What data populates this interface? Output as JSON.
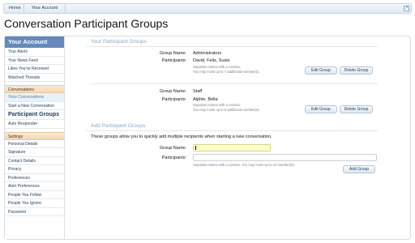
{
  "breadcrumb": {
    "home": "Home",
    "account": "Your Account",
    "jump_icon": "external-link-icon"
  },
  "page_title": "Conversation Participant Groups",
  "sidebar": {
    "header": "Your Account",
    "items_top": [
      "Your Alerts",
      "Your News Feed",
      "Likes You've Received",
      "Watched Threads"
    ],
    "conversations_section": "Conversations",
    "conv_items": [
      "View Conversations",
      "Start a New Conversation"
    ],
    "participant_groups": "Participant Groups",
    "auto_responder": "Auto Responder",
    "settings_section": "Settings",
    "settings_items": [
      "Personal Details",
      "Signature",
      "Contact Details",
      "Privacy",
      "Preferences",
      "Alert Preferences",
      "People You Follow",
      "People You Ignore",
      "Password"
    ]
  },
  "your_groups": {
    "title": "Your Participant Groups",
    "group_name_label": "Group Name:",
    "participants_label": "Participants:",
    "edit_label": "Edit Group",
    "delete_label": "Delete Group",
    "groups": [
      {
        "name": "Administrators",
        "participants": "David, Felix, Susie",
        "hint1": "Separate names with a comma.",
        "hint2": "You may invite up to 7 additional member(s)."
      },
      {
        "name": "Staff",
        "participants": "Alphie, Bella",
        "hint1": "Separate names with a comma.",
        "hint2": "You may invite up to 8 additional member(s)."
      }
    ]
  },
  "add_group": {
    "title": "Add Participant Groups",
    "intro": "These groups allow you to quickly add multiple recipients when starting a new conversation.",
    "group_name_label": "Group Name:",
    "participants_label": "Participants:",
    "group_name_value": "",
    "participants_value": "",
    "hint": "Separate names with a comma. You may invite up to 10 member(s).",
    "button": "Add Group"
  }
}
